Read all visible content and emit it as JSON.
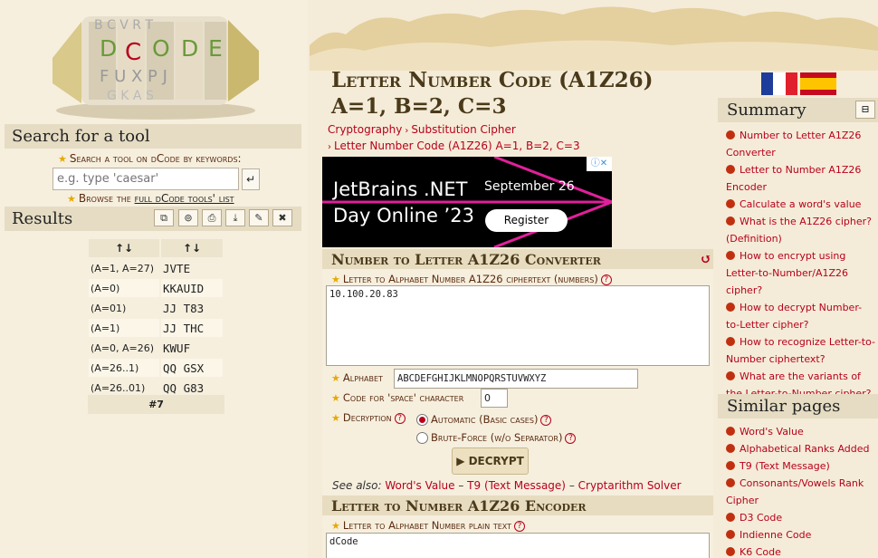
{
  "left": {
    "search_title": "Search for a tool",
    "search_prompt": "Search a tool on dCode by keywords:",
    "search_placeholder": "e.g. type 'caesar'",
    "browse_prefix": "Browse the ",
    "browse_link": "full dCode tools' list",
    "results_title": "Results",
    "results_header": [
      "↑↓",
      "↑↓"
    ],
    "results": [
      {
        "param": "(A=1, A=27)",
        "output": "JVTE"
      },
      {
        "param": "(A=0)",
        "output": "KKAUID"
      },
      {
        "param": "(A=01)",
        "output": "JJ T83"
      },
      {
        "param": "(A=1)",
        "output": "JJ THC"
      },
      {
        "param": "(A=0, A=26)",
        "output": "KWUF"
      },
      {
        "param": "(A=26..1)",
        "output": "QQ GSX"
      },
      {
        "param": "(A=26..01)",
        "output": "QQ G83"
      }
    ],
    "results_count": "#7"
  },
  "main": {
    "title_line1": "Letter Number Code (A1Z26)",
    "title_line2": "A=1, B=2, C=3",
    "breadcrumb": [
      "Cryptography",
      "Substitution Cipher",
      "Letter Number Code (A1Z26) A=1, B=2, C=3"
    ],
    "ad": {
      "line1": "JetBrains .NET",
      "date": "September 26",
      "line2": "Day Online ’23",
      "register": "Register"
    },
    "converter": {
      "title": "Number to Letter A1Z26 Converter",
      "ciphertext_label": "Letter to Alphabet Number A1Z26 ciphertext (numbers)",
      "ciphertext_value": "10.100.20.83",
      "alphabet_label": "Alphabet",
      "alphabet_value": "ABCDEFGHIJKLMNOPQRSTUVWXYZ",
      "space_label": "Code for 'space' character",
      "space_value": "0",
      "decryption_label": "Decryption",
      "option_auto": "Automatic (Basic cases)",
      "option_brute": "Brute-Force (w/o Separator)",
      "decrypt_button": "DECRYPT",
      "see_also_label": "See also:",
      "see_also_links": [
        "Word's Value",
        "T9 (Text Message)",
        "Cryptarithm Solver"
      ]
    },
    "encoder": {
      "title": "Letter to Number A1Z26 Encoder",
      "plaintext_label": "Letter to Alphabet Number plain text",
      "plaintext_value": "dCode"
    }
  },
  "right": {
    "summary_title": "Summary",
    "summary_items": [
      "Number to Letter A1Z26 Converter",
      "Letter to Number A1Z26 Encoder",
      "Calculate a word's value",
      "What is the A1Z26 cipher? (Definition)",
      "How to encrypt using Letter-to-Number/A1Z26 cipher?",
      "How to decrypt Number-to-Letter cipher?",
      "How to recognize Letter-to-Number ciphertext?",
      "What are the variants of the Letter-to-Number cipher?"
    ],
    "similar_title": "Similar pages",
    "similar_items": [
      "Word's Value",
      "Alphabetical Ranks Added",
      "T9 (Text Message)",
      "Consonants/Vowels Rank Cipher",
      "D3 Code",
      "Indienne Code",
      "K6 Code"
    ]
  },
  "colors": {
    "accent_red": "#b8001c",
    "parchment": "#f4ecd8",
    "panel_header": "#e5dcc3"
  }
}
